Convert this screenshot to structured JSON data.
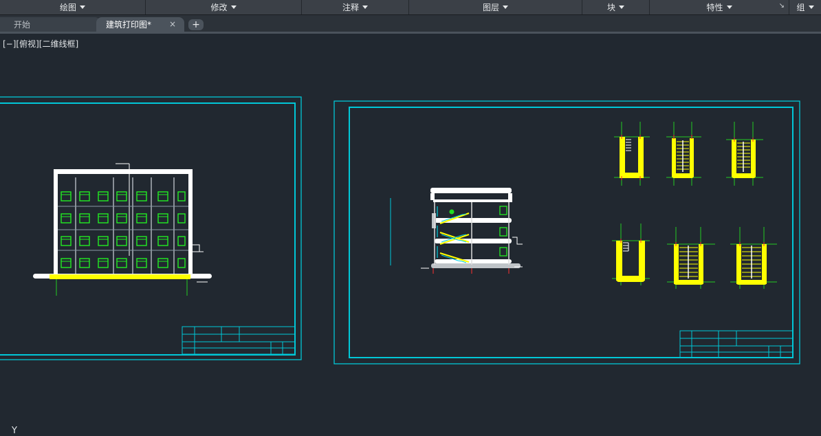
{
  "ribbon": {
    "panels": [
      {
        "label": "绘图",
        "has_dropdown": true
      },
      {
        "label": "修改",
        "has_dropdown": true
      },
      {
        "label": "注释",
        "has_dropdown": true
      },
      {
        "label": "图层",
        "has_dropdown": true
      },
      {
        "label": "块",
        "has_dropdown": true
      },
      {
        "label": "特性",
        "has_dropdown": true,
        "launcher": "↘"
      },
      {
        "label": "组",
        "has_dropdown": true
      }
    ]
  },
  "tabs": {
    "items": [
      {
        "label": "开始",
        "active": false
      },
      {
        "label": "建筑打印图*",
        "active": true,
        "close": "×"
      }
    ],
    "add_label": "+"
  },
  "viewport": {
    "label": "[−][俯视][二维线框]"
  },
  "ucs": {
    "y_label": "Y"
  },
  "colors": {
    "background": "#212830",
    "frame": "cyan",
    "window": "lime",
    "stair": "yellow",
    "wall": "white",
    "axis": "red"
  }
}
